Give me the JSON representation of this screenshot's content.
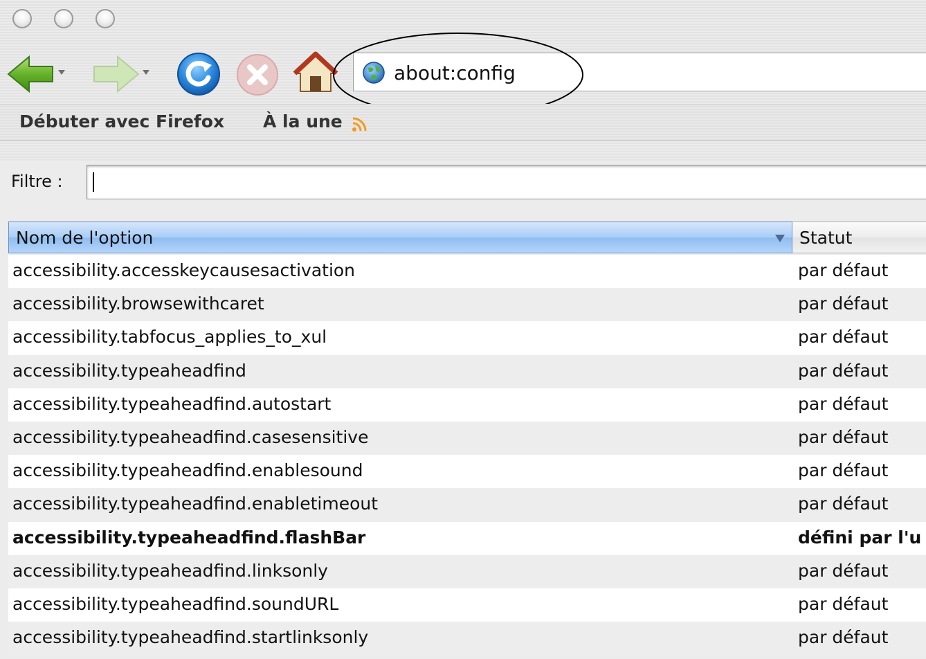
{
  "window": {
    "buttons": [
      "close",
      "minimize",
      "zoom"
    ]
  },
  "toolbar": {
    "back_icon": "back-arrow-icon",
    "forward_icon": "forward-arrow-icon",
    "reload_icon": "reload-icon",
    "stop_icon": "stop-icon",
    "home_icon": "home-icon",
    "url": "about:config",
    "annotation": "ellipse highlighting address bar"
  },
  "bookmarks": {
    "items": [
      {
        "label": "Débuter avec Firefox"
      },
      {
        "label": "À la une",
        "icon": "rss-icon"
      }
    ]
  },
  "filter": {
    "label": "Filtre :",
    "value": ""
  },
  "table": {
    "columns": [
      "Nom de l'option",
      "Statut"
    ],
    "rows": [
      {
        "name": "accessibility.accesskeycausesactivation",
        "status": "par défaut"
      },
      {
        "name": "accessibility.browsewithcaret",
        "status": "par défaut"
      },
      {
        "name": "accessibility.tabfocus_applies_to_xul",
        "status": "par défaut"
      },
      {
        "name": "accessibility.typeaheadfind",
        "status": "par défaut"
      },
      {
        "name": "accessibility.typeaheadfind.autostart",
        "status": "par défaut"
      },
      {
        "name": "accessibility.typeaheadfind.casesensitive",
        "status": "par défaut"
      },
      {
        "name": "accessibility.typeaheadfind.enablesound",
        "status": "par défaut"
      },
      {
        "name": "accessibility.typeaheadfind.enabletimeout",
        "status": "par défaut"
      },
      {
        "name": "accessibility.typeaheadfind.flashBar",
        "status": "défini par l'u"
      },
      {
        "name": "accessibility.typeaheadfind.linksonly",
        "status": "par défaut"
      },
      {
        "name": "accessibility.typeaheadfind.soundURL",
        "status": "par défaut"
      },
      {
        "name": "accessibility.typeaheadfind.startlinksonly",
        "status": "par défaut"
      }
    ]
  },
  "colors": {
    "header_blue": "#a9cdf6",
    "row_alt": "#ededed",
    "rss_orange": "#f39a1f"
  }
}
